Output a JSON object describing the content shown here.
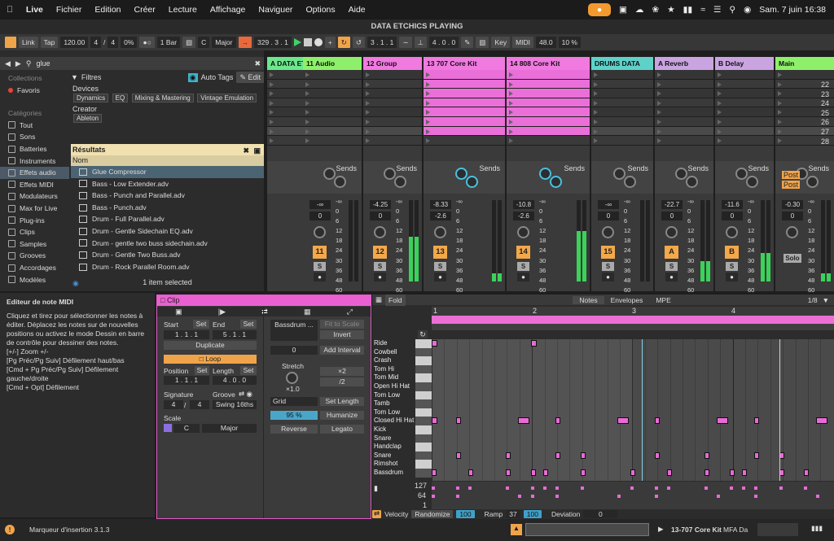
{
  "menubar": {
    "app": "Live",
    "menus": [
      "Fichier",
      "Edition",
      "Créer",
      "Lecture",
      "Affichage",
      "Naviguer",
      "Options",
      "Aide"
    ],
    "datetime": "Sam. 7 juin  16:38"
  },
  "window": {
    "title": "DATA ETCHICS PLAYING"
  },
  "transport": {
    "link": "Link",
    "tap": "Tap",
    "tempo": "120.00",
    "sig_num": "4",
    "sig_den": "4",
    "percent": "0%",
    "quant": "1 Bar",
    "key": "C",
    "scale": "Major",
    "position": "329 .  3 .  1",
    "loop_start": "3 .  1 .  1",
    "loop_len": "4 .  0 .  0",
    "key_btn": "Key",
    "midi_btn": "MIDI",
    "sample_rate": "48.0",
    "cpu": "10 %"
  },
  "browser": {
    "search": "glue",
    "collections_label": "Collections",
    "favoris": "Favoris",
    "categories_label": "Catégories",
    "categories": [
      "Tout",
      "Sons",
      "Batteries",
      "Instruments",
      "Effets audio",
      "Effets MIDI",
      "Modulateurs",
      "Max for Live",
      "Plug-ins",
      "Clips",
      "Samples",
      "Grooves",
      "Accordages",
      "Modèles"
    ],
    "filtres": "Filtres",
    "auto_tags": "Auto Tags",
    "edit": "Edit",
    "devices": "Devices",
    "chips": [
      "Dynamics",
      "EQ",
      "Mixing & Mastering",
      "Vintage Emulation"
    ],
    "creator": "Creator",
    "creator_chip": "Ableton",
    "results": "Résultats",
    "nom": "Nom",
    "items": [
      "Glue Compressor",
      "Bass - Low Extender.adv",
      "Bass - Punch and Parallel.adv",
      "Bass - Punch.adv",
      "Drum - Full Parallel.adv",
      "Drum - Gentle Sidechain EQ.adv",
      "Drum - gentle two buss sidechain.adv",
      "Drum - Gentle Two Buss.adv",
      "Drum - Rock Parallel Room.adv"
    ],
    "selected": "1 item selected"
  },
  "tracks": [
    {
      "name": "A DATA ET",
      "color": "#6ce78c",
      "vol": "",
      "pan": "",
      "num": ""
    },
    {
      "name": "11 Audio",
      "color": "#8ef06a",
      "vol": "-∞",
      "pan": "0",
      "num": "11"
    },
    {
      "name": "12 Group",
      "color": "#f07ae0",
      "vol": "-4.25",
      "pan": "0",
      "num": "12"
    },
    {
      "name": "13 707 Core Kit",
      "color": "#f07ae0",
      "vol": "-8.33",
      "pan": "-2.6",
      "num": "13",
      "v1": "26",
      "v2": "16"
    },
    {
      "name": "14 808 Core Kit",
      "color": "#f07ae0",
      "vol": "-10.8",
      "pan": "-2.6",
      "num": "14",
      "v1": "104",
      "v2": "4"
    },
    {
      "name": "DRUMS DATA",
      "color": "#5fd1c9",
      "vol": "-∞",
      "pan": "0",
      "num": "15"
    },
    {
      "name": "A Reverb",
      "color": "#c9a4e0",
      "vol": "-22.7",
      "pan": "0",
      "num": "A"
    },
    {
      "name": "B Delay",
      "color": "#c9a4e0",
      "vol": "-11.6",
      "pan": "0",
      "num": "B"
    },
    {
      "name": "Main",
      "color": "#8ef06a",
      "vol": "-0.30",
      "pan": "0",
      "num": ""
    }
  ],
  "mixer": {
    "sends": "Sends",
    "scale": [
      "-∞",
      "0",
      "6",
      "12",
      "18",
      "24",
      "30",
      "36",
      "48",
      "60"
    ],
    "post": "Post",
    "solo": "Solo",
    "s": "S"
  },
  "scenes": [
    "22",
    "23",
    "24",
    "25",
    "26",
    "27",
    "28"
  ],
  "info": {
    "title": "Editeur de note MIDI",
    "text": "Cliquez et tirez pour sélectionner les notes à éditer. Déplacez les notes sur de nouvelles positions ou activez le mode Dessin en barre de contrôle pour dessiner des notes.",
    "lines": [
      "[+/-] Zoom +/-",
      "[Pg Préc/Pg Suiv] Défilement haut/bas",
      "[Cmd + Pg Préc/Pg Suiv] Défilement gauche/droite",
      "[Cmd + Opt] Défilement"
    ]
  },
  "clip": {
    "title": "Clip",
    "start": "Start",
    "end": "End",
    "set": "Set",
    "start_val": "1 .  1 .  1",
    "end_val": "5 .  1 .  1",
    "duplicate": "Duplicate",
    "loop": "Loop",
    "position": "Position",
    "length": "Length",
    "pos_val": "1 .  1 .  1",
    "len_val": "4 .  0 .  0",
    "signature": "Signature",
    "groove": "Groove",
    "sig_num": "4",
    "sig_den": "4",
    "groove_val": "Swing 16ths",
    "scale": "Scale",
    "scale_key": "C",
    "scale_mode": "Major",
    "sample": "Bassdrum ...",
    "fit": "Fit to Scale",
    "invert": "Invert",
    "interval_val": "0",
    "add_interval": "Add Interval",
    "stretch": "Stretch",
    "stretch_val": "×1.0",
    "x2": "×2",
    "d2": "/2",
    "grid": "Grid",
    "set_length": "Set Length",
    "pct": "95 %",
    "humanize": "Humanize",
    "reverse": "Reverse",
    "legato": "Legato"
  },
  "editor": {
    "fold": "Fold",
    "notes": "Notes",
    "envelopes": "Envelopes",
    "mpe": "MPE",
    "grid_val": "1/8",
    "bars": [
      "1",
      "2",
      "3",
      "4"
    ],
    "keys": [
      "Ride",
      "Cowbell",
      "Crash",
      "Tom Hi",
      "Tom Mid",
      "Open Hi Hat",
      "Tom Low",
      "Tamb",
      "Tom Low",
      "Closed Hi Hat",
      "Kick",
      "Snare",
      "Handclap",
      "Snare",
      "Rimshot",
      "Bassdrum"
    ],
    "vel_scale": [
      "127",
      "64",
      "1"
    ],
    "velocity": "Velocity",
    "randomize": "Randomize",
    "rand_val": "100",
    "ramp": "Ramp",
    "ramp_val": "37",
    "ramp_val2": "100",
    "deviation": "Deviation",
    "dev_val": "0"
  },
  "status": {
    "text": "Marqueur d'insertion 3.1.3",
    "track": "13-707 Core Kit",
    "device": "MFA Da"
  }
}
